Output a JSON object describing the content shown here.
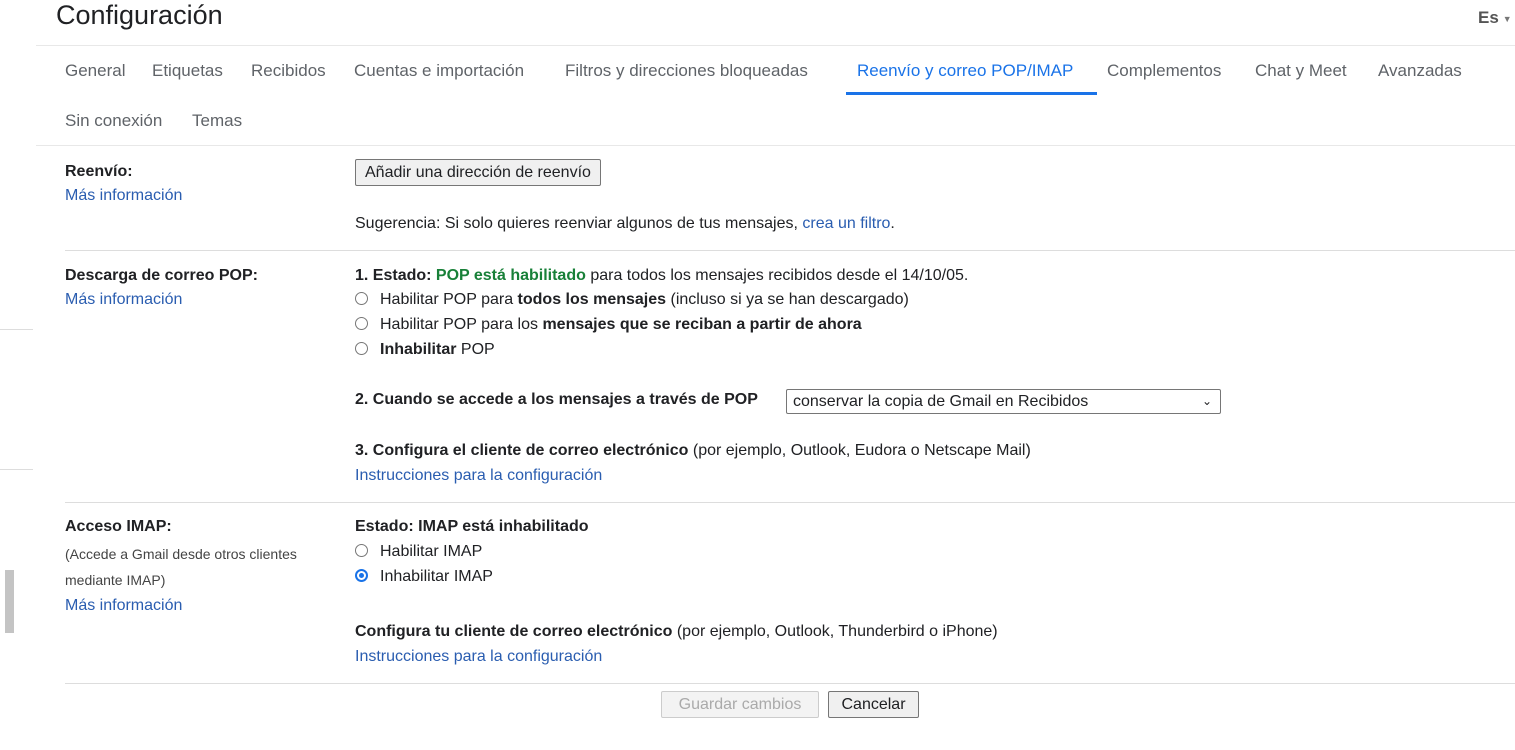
{
  "header": {
    "title": "Configuración",
    "language": "Es"
  },
  "tabs": [
    {
      "label": "General"
    },
    {
      "label": "Etiquetas"
    },
    {
      "label": "Recibidos"
    },
    {
      "label": "Cuentas e importación"
    },
    {
      "label": "Filtros y direcciones bloqueadas"
    },
    {
      "label": "Reenvío y correo POP/IMAP",
      "active": true
    },
    {
      "label": "Complementos"
    },
    {
      "label": "Chat y Meet"
    },
    {
      "label": "Avanzadas"
    },
    {
      "label": "Sin conexión"
    },
    {
      "label": "Temas"
    }
  ],
  "forwarding": {
    "label": "Reenvío:",
    "more_info": "Más información",
    "add_button": "Añadir una dirección de reenvío",
    "hint_prefix": "Sugerencia: Si solo quieres reenviar algunos de tus mensajes, ",
    "hint_link": "crea un filtro",
    "hint_suffix": "."
  },
  "pop": {
    "label": "Descarga de correo POP:",
    "more_info": "Más información",
    "status_prefix": "1. Estado: ",
    "status_value": "POP está habilitado",
    "status_suffix": " para todos los mensajes recibidos desde el 14/10/05.",
    "options": [
      {
        "pre": "Habilitar POP para ",
        "bold": "todos los mensajes",
        "post": " (incluso si ya se han descargado)",
        "selected": false
      },
      {
        "pre": "Habilitar POP para los ",
        "bold": "mensajes que se reciban a partir de ahora",
        "post": "",
        "selected": false
      },
      {
        "pre": "",
        "bold": "Inhabilitar",
        "post": " POP",
        "selected": false
      }
    ],
    "access_label": "2. Cuando se accede a los mensajes a través de POP",
    "access_value": "conservar la copia de Gmail en Recibidos",
    "config_label": "3. Configura el cliente de correo electrónico",
    "config_suffix": " (por ejemplo, Outlook, Eudora o Netscape Mail)",
    "config_link": "Instrucciones para la configuración"
  },
  "imap": {
    "label": "Acceso IMAP:",
    "desc_line1": "(Accede a Gmail desde otros clientes",
    "desc_line2": "mediante IMAP)",
    "more_info": "Más información",
    "status": "Estado: IMAP está inhabilitado",
    "options": [
      {
        "label": "Habilitar IMAP",
        "selected": false
      },
      {
        "label": "Inhabilitar IMAP",
        "selected": true
      }
    ],
    "config_label": "Configura tu cliente de correo electrónico",
    "config_suffix": " (por ejemplo, Outlook, Thunderbird o iPhone)",
    "config_link": "Instrucciones para la configuración"
  },
  "footer": {
    "save": "Guardar cambios",
    "cancel": "Cancelar"
  },
  "colors": {
    "accent": "#1a73e8",
    "link": "#2a5db0",
    "enabled": "#188038"
  }
}
